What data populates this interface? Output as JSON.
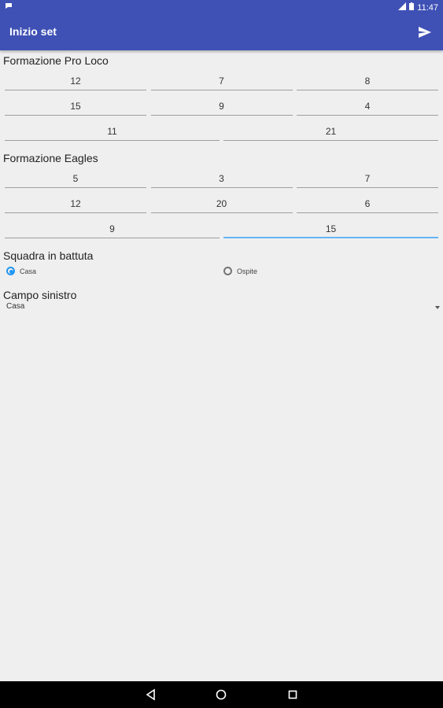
{
  "status_bar": {
    "time": "11:47"
  },
  "app_bar": {
    "title": "Inizio set"
  },
  "team_home": {
    "title": "Formazione Pro Loco",
    "row1": [
      "12",
      "7",
      "8"
    ],
    "row2": [
      "15",
      "9",
      "4"
    ],
    "row3": [
      "11",
      "21"
    ]
  },
  "team_away": {
    "title": "Formazione Eagles",
    "row1": [
      "5",
      "3",
      "7"
    ],
    "row2": [
      "12",
      "20",
      "6"
    ],
    "row3": [
      "9",
      "15"
    ]
  },
  "serving": {
    "title": "Squadra in battuta",
    "options": [
      "Casa",
      "Ospite"
    ],
    "selected": "Casa"
  },
  "left_field": {
    "title": "Campo sinistro",
    "value": "Casa"
  },
  "colors": {
    "primary": "#3f51b5",
    "accent": "#2196f3",
    "background": "#efefef"
  },
  "icons": [
    "notification-icon",
    "signal-icon",
    "battery-icon",
    "send-icon",
    "back-icon",
    "home-icon",
    "recents-icon",
    "dropdown-arrow-icon"
  ]
}
